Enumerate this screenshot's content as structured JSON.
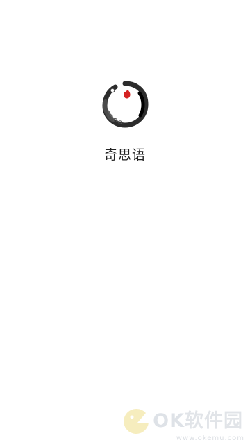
{
  "app": {
    "name": "奇思语"
  },
  "logo": {
    "icon": "ink-circle-logo-icon",
    "accent_color": "#d42222",
    "ink_color": "#1a1a1a"
  },
  "watermark": {
    "icon": "pacman-watermark-icon",
    "brand_ok": "OK",
    "brand_cn": "软件园",
    "url": "www.okemu.com",
    "color": "#c9cfd6",
    "icon_color": "#f0e08a"
  }
}
